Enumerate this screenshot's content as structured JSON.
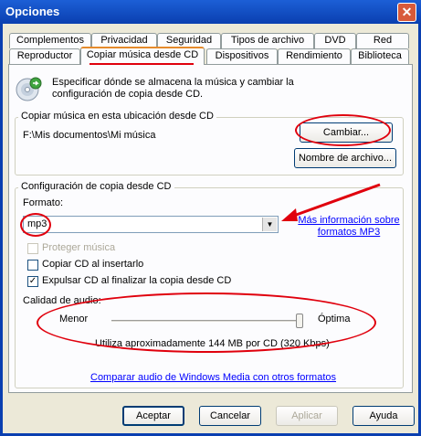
{
  "window": {
    "title": "Opciones",
    "close_glyph": "✕"
  },
  "tabs_row1": [
    {
      "label": "Complementos"
    },
    {
      "label": "Privacidad"
    },
    {
      "label": "Seguridad"
    },
    {
      "label": "Tipos de archivo"
    },
    {
      "label": "DVD"
    },
    {
      "label": "Red"
    }
  ],
  "tabs_row2": [
    {
      "label": "Reproductor"
    },
    {
      "label": "Copiar música desde CD",
      "active": true
    },
    {
      "label": "Dispositivos"
    },
    {
      "label": "Rendimiento"
    },
    {
      "label": "Biblioteca"
    }
  ],
  "header": {
    "icon": "cd-copy-icon",
    "description": "Especificar dónde se almacena la música y cambiar la configuración de copia desde CD."
  },
  "location_group": {
    "legend": "Copiar música en esta ubicación desde CD",
    "path": "F:\\Mis documentos\\Mi música",
    "change_button": "Cambiar...",
    "filename_button": "Nombre de archivo..."
  },
  "settings_group": {
    "legend": "Configuración de copia desde CD",
    "format_label": "Formato:",
    "format_value": "mp3",
    "format_link": "Más información sobre formatos MP3",
    "protect_label": "Proteger música",
    "protect_checked": false,
    "protect_disabled": true,
    "copy_on_insert_label": "Copiar CD al insertarlo",
    "copy_on_insert_checked": false,
    "eject_label": "Expulsar CD al finalizar la copia desde CD",
    "eject_checked": true,
    "quality_label": "Calidad de audio:",
    "quality_min": "Menor",
    "quality_max": "Óptima",
    "quality_level": 1.0,
    "quality_note": "Utiliza aproximadamente 144 MB por CD (320 Kbps)"
  },
  "compare_link": "Comparar audio de Windows Media con otros formatos",
  "buttons": {
    "ok": "Aceptar",
    "cancel": "Cancelar",
    "apply": "Aplicar",
    "help": "Ayuda"
  },
  "colors": {
    "annotation": "#e0000d",
    "titlebar": "#0a3fb0",
    "tab_accent": "#e68b2c"
  }
}
